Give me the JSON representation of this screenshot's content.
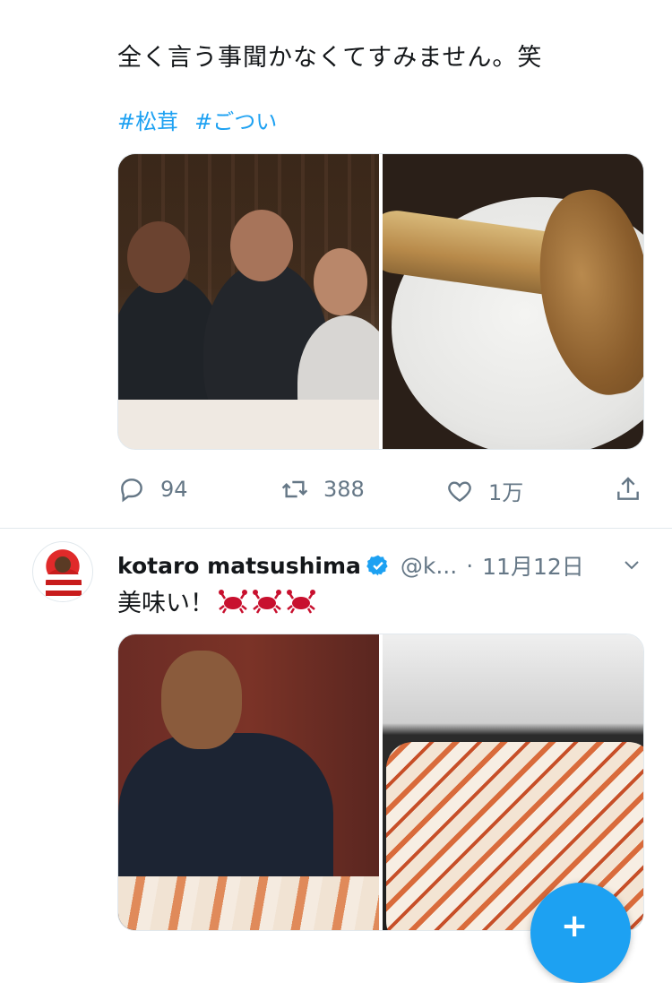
{
  "tweet1": {
    "text": "全く言う事聞かなくてすみません。笑",
    "hashtags": [
      "#松茸",
      "#ごつい"
    ],
    "actions": {
      "replies": "94",
      "retweets": "388",
      "likes": "1万"
    }
  },
  "tweet2": {
    "name": "kotaro matsushima",
    "handle": "@k...",
    "separator": "·",
    "date": "11月12日",
    "text": "美味い！"
  },
  "colors": {
    "accent": "#1da1f2",
    "muted": "#657786",
    "crab": "#c8102e"
  },
  "icons": [
    "reply-icon",
    "retweet-icon",
    "like-icon",
    "share-icon",
    "verified-icon",
    "chevron-down-icon",
    "crab-emoji",
    "compose-icon"
  ]
}
